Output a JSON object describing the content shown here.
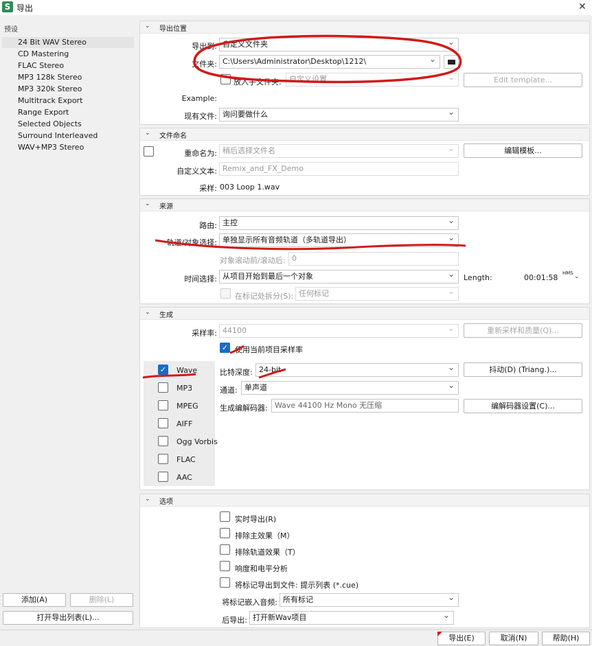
{
  "window": {
    "title": "导出",
    "app_icon_letter": "S",
    "close_glyph": "✕"
  },
  "sidebar": {
    "heading": "预设",
    "presets": [
      "24 Bit WAV Stereo",
      "CD Mastering",
      "FLAC Stereo",
      "MP3 128k Stereo",
      "MP3 320k Stereo",
      "Multitrack Export",
      "Range Export",
      "Selected Objects",
      "Surround Interleaved",
      "WAV+MP3 Stereo"
    ],
    "selected_index": 0,
    "add_label": "添加(A)",
    "delete_label": "删除(L)",
    "open_list_label": "打开导出列表(L)..."
  },
  "location": {
    "title": "导出位置",
    "export_to_label": "导出到:",
    "export_to_value": "自定义文件夹",
    "folder_label": "文件夹:",
    "folder_value": "C:\\Users\\Administrator\\Desktop\\1212\\",
    "subfolder_label": "放入子文件夹:",
    "subfolder_value": "自定义设置",
    "edit_template_label": "Edit template...",
    "example_label": "Example:",
    "existing_label": "现有文件:",
    "existing_value": "询问要做什么"
  },
  "naming": {
    "title": "文件命名",
    "rename_label": "重命名为:",
    "rename_value": "稍后选择文件名",
    "edit_template_label": "编辑模板...",
    "custom_text_label": "自定义文本:",
    "custom_text_placeholder": "Remix_and_FX_Demo",
    "sample_label": "采样:",
    "sample_value": "003 Loop 1.wav"
  },
  "source": {
    "title": "来源",
    "route_label": "路由:",
    "route_value": "主控",
    "track_label": "轨道/对象选择:",
    "track_value": "单独显示所有音频轨道（多轨道导出）",
    "scroll_label": "对象滚动前/滚动后:",
    "scroll_value": "0",
    "time_label": "时间选择:",
    "time_value": "从项目开始到最后一个对象",
    "length_label": "Length:",
    "length_value": "00:01:58",
    "hms_label": "HMS",
    "split_label": "在标记处拆分(S):",
    "split_value": "任何标记"
  },
  "generate": {
    "title": "生成",
    "samplerate_label": "采样率:",
    "samplerate_value": "44100",
    "resample_label": "重新采样和质量(Q)...",
    "use_project_rate_label": "使用当前项目采样率",
    "formats": [
      "Wave",
      "MP3",
      "MPEG",
      "AIFF",
      "Ogg Vorbis",
      "FLAC",
      "AAC"
    ],
    "format_checked": [
      true,
      false,
      false,
      false,
      false,
      false,
      false
    ],
    "bitdepth_label": "比特深度:",
    "bitdepth_value": "24-bit",
    "dither_label": "抖动(D) (Triang.)...",
    "channel_label": "通道:",
    "channel_value": "单声道",
    "codec_label": "生成编解码器:",
    "codec_value": "Wave 44100 Hz  Mono  无压缩",
    "codec_settings_label": "编解码器设置(C)..."
  },
  "options": {
    "title": "选项",
    "checks": [
      "实时导出(R)",
      "排除主效果（M）",
      "排除轨道效果（T）",
      "响度和电平分析",
      "将标记导出到文件: 提示列表 (*.cue)"
    ],
    "embed_label": "将标记嵌入音频:",
    "embed_value": "所有标记",
    "after_label": "后导出:",
    "after_value": "打开新Wav项目"
  },
  "footer": {
    "export_label": "导出(E)",
    "cancel_label": "取消(N)",
    "help_label": "帮助(H)"
  },
  "colors": {
    "accent": "#1a6cc4",
    "annotation": "#d11a1a"
  }
}
